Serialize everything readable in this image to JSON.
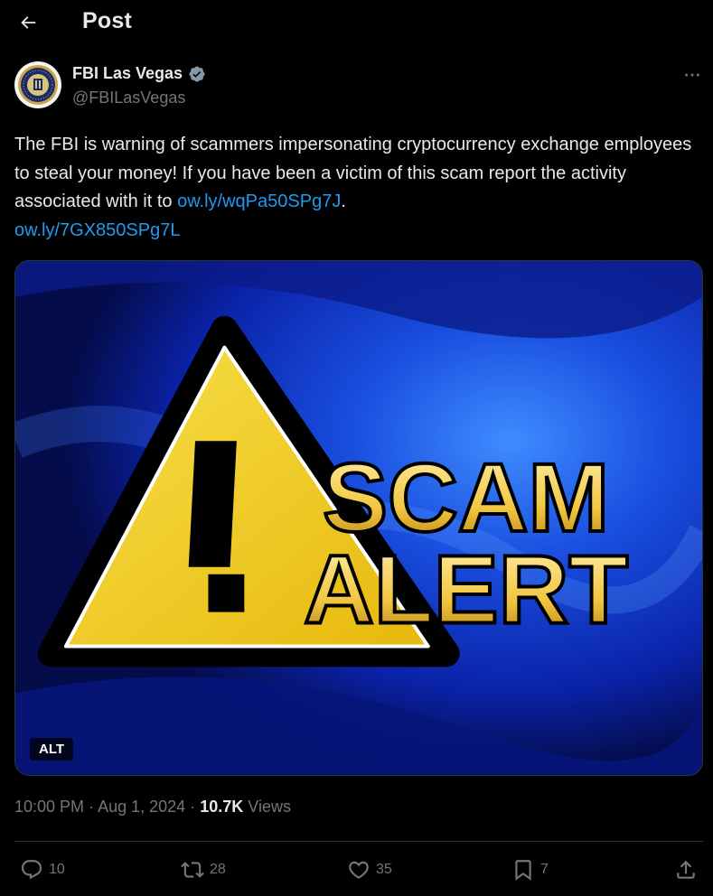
{
  "header": {
    "title": "Post",
    "back_icon": "arrow-left-icon"
  },
  "author": {
    "name": "FBI Las Vegas",
    "handle": "@FBILasVegas",
    "verified_icon": "verified-badge-icon",
    "avatar": "fbi-seal-avatar"
  },
  "post": {
    "text_before_link": "The FBI is warning of scammers impersonating cryptocurrency exchange employees to steal your money! If you have been a victim of this scam report the activity associated with it to ",
    "link1": "ow.ly/wqPa50SPg7J",
    "text_after_link1": ".",
    "link2": "ow.ly/7GX850SPg7L",
    "media": {
      "alt_badge": "ALT",
      "headline_line1": "SCAM",
      "headline_line2": "ALERT",
      "warning_mark": "!"
    }
  },
  "meta": {
    "time": "10:00 PM",
    "separator": "·",
    "date": "Aug 1, 2024",
    "views_count": "10.7K",
    "views_label": "Views"
  },
  "actions": {
    "replies": "10",
    "reposts": "28",
    "likes": "35",
    "bookmarks": "7"
  },
  "colors": {
    "background": "#000000",
    "text": "#e7e9ea",
    "muted": "#71767b",
    "link": "#1d9bf0",
    "verified": "#829aab"
  }
}
